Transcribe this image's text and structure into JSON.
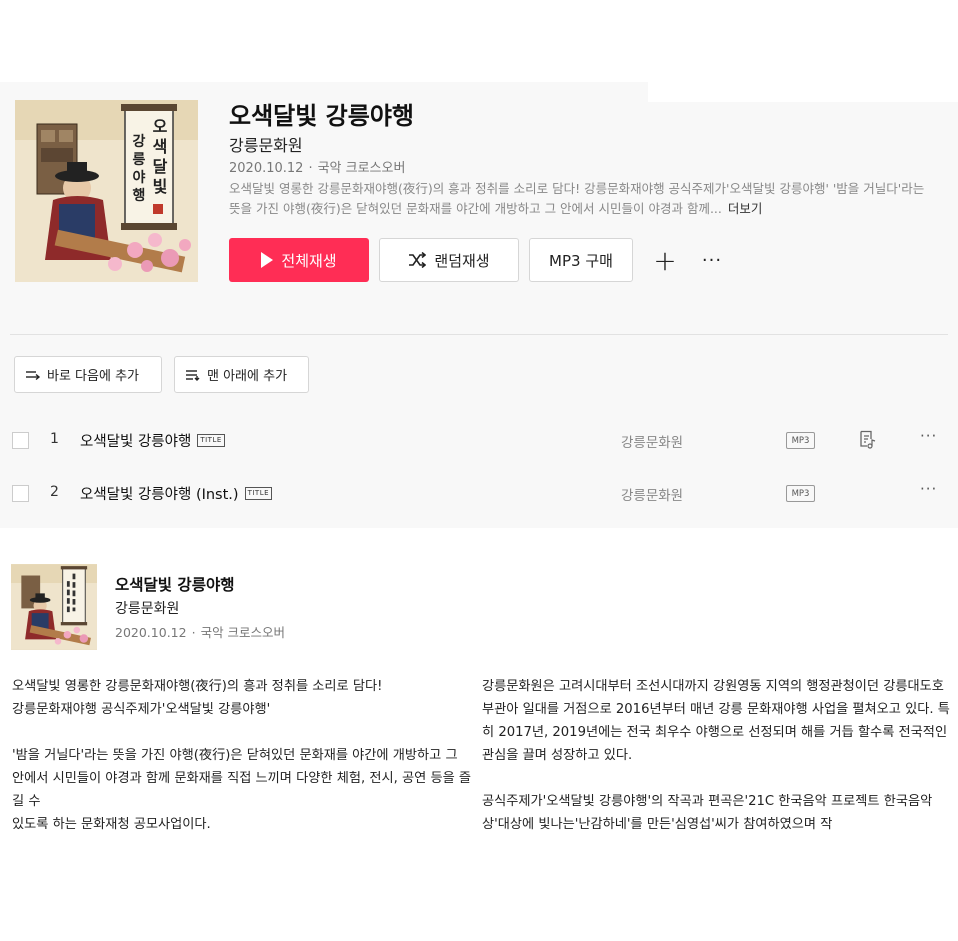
{
  "album": {
    "title": "오색달빛 강릉야행",
    "artist": "강릉문화원",
    "date": "2020.10.12",
    "genre": "국악 크로스오버",
    "description": "오색달빛 영롱한 강릉문화재야행(夜行)의 흥과 정취를 소리로 담다! 강릉문화재야행 공식주제가'오색달빛 강릉야행' '밤을 거닐다'라는 뜻을 가진 야행(夜行)은 닫혀있던 문화재를 야간에 개방하고 그 안에서 시민들이 야경과 함께...",
    "more_label": "더보기",
    "cover_text": "오색달빛 강릉야행",
    "cover_text_chars": [
      "오",
      "색",
      "달",
      "빛",
      "강",
      "릉",
      "야",
      "행"
    ]
  },
  "actions": {
    "play_all": "전체재생",
    "shuffle": "랜덤재생",
    "mp3_buy": "MP3 구매",
    "add": "+",
    "more": "···"
  },
  "queue": {
    "add_next": "바로 다음에 추가",
    "add_last": "맨 아래에 추가"
  },
  "tracks": [
    {
      "num": "1",
      "title": "오색달빛 강릉야행",
      "badge": "TITLE",
      "artist": "강릉문화원",
      "format": "MP3",
      "has_lyrics": true,
      "more": "···"
    },
    {
      "num": "2",
      "title": "오색달빛 강릉야행 (Inst.)",
      "badge": "TITLE",
      "artist": "강릉문화원",
      "format": "MP3",
      "has_lyrics": false,
      "more": "···"
    }
  ],
  "info": {
    "title": "오색달빛 강릉야행",
    "artist": "강릉문화원",
    "date": "2020.10.12",
    "genre": "국악 크로스오버",
    "left_paragraphs": [
      "오색달빛 영롱한 강릉문화재야행(夜行)의 흥과 정취를 소리로 담다!",
      "강릉문화재야행 공식주제가'오색달빛 강릉야행'",
      "",
      "'밤을 거닐다'라는 뜻을 가진 야행(夜行)은 닫혀있던 문화재를 야간에 개방하고 그",
      "안에서 시민들이 야경과 함께 문화재를 직접 느끼며 다양한 체험, 전시, 공연 등을 즐길 수",
      "있도록 하는 문화재청 공모사업이다."
    ],
    "right_paragraphs": [
      "강릉문화원은 고려시대부터 조선시대까지 강원영동 지역의 행정관청이던 강릉대도호부관아 일대를 거점으로 2016년부터 매년 강릉 문화재야행 사업을 펼쳐오고 있다. 특히 2017년, 2019년에는 전국 최우수 야행으로 선정되며 해를 거듭 할수록 전국적인 관심을 끌며 성장하고 있다.",
      "",
      "공식주제가'오색달빛 강릉야행'의 작곡과 편곡은'21C 한국음악 프로젝트 한국음악상'대상에 빛나는'난감하네'를 만든'심영섭'씨가 참여하였으며 작"
    ]
  },
  "colors": {
    "accent": "#ff2d55",
    "panel_bg": "#f8f8f8",
    "muted_text": "#888888"
  }
}
